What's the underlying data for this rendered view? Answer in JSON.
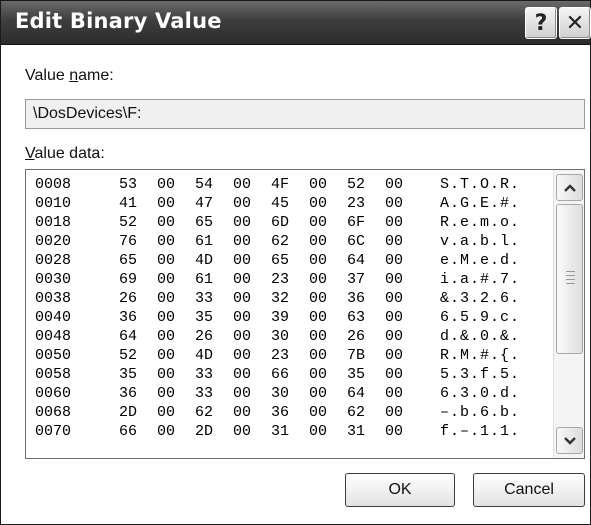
{
  "window": {
    "title": "Edit Binary Value"
  },
  "titlebar": {
    "help_glyph": "?",
    "close_glyph": "✕"
  },
  "value_name": {
    "label_prefix": "Value ",
    "label_accel": "n",
    "label_suffix": "ame:",
    "value": "\\DosDevices\\F:"
  },
  "value_data": {
    "label_accel": "V",
    "label_suffix": "alue data:",
    "rows": [
      {
        "offset": "0008",
        "bytes": [
          "53",
          "00",
          "54",
          "00",
          "4F",
          "00",
          "52",
          "00"
        ],
        "ascii": "S.T.O.R."
      },
      {
        "offset": "0010",
        "bytes": [
          "41",
          "00",
          "47",
          "00",
          "45",
          "00",
          "23",
          "00"
        ],
        "ascii": "A.G.E.#."
      },
      {
        "offset": "0018",
        "bytes": [
          "52",
          "00",
          "65",
          "00",
          "6D",
          "00",
          "6F",
          "00"
        ],
        "ascii": "R.e.m.o."
      },
      {
        "offset": "0020",
        "bytes": [
          "76",
          "00",
          "61",
          "00",
          "62",
          "00",
          "6C",
          "00"
        ],
        "ascii": "v.a.b.l."
      },
      {
        "offset": "0028",
        "bytes": [
          "65",
          "00",
          "4D",
          "00",
          "65",
          "00",
          "64",
          "00"
        ],
        "ascii": "e.M.e.d."
      },
      {
        "offset": "0030",
        "bytes": [
          "69",
          "00",
          "61",
          "00",
          "23",
          "00",
          "37",
          "00"
        ],
        "ascii": "i.a.#.7."
      },
      {
        "offset": "0038",
        "bytes": [
          "26",
          "00",
          "33",
          "00",
          "32",
          "00",
          "36",
          "00"
        ],
        "ascii": "&.3.2.6."
      },
      {
        "offset": "0040",
        "bytes": [
          "36",
          "00",
          "35",
          "00",
          "39",
          "00",
          "63",
          "00"
        ],
        "ascii": "6.5.9.c."
      },
      {
        "offset": "0048",
        "bytes": [
          "64",
          "00",
          "26",
          "00",
          "30",
          "00",
          "26",
          "00"
        ],
        "ascii": "d.&.0.&."
      },
      {
        "offset": "0050",
        "bytes": [
          "52",
          "00",
          "4D",
          "00",
          "23",
          "00",
          "7B",
          "00"
        ],
        "ascii": "R.M.#.{."
      },
      {
        "offset": "0058",
        "bytes": [
          "35",
          "00",
          "33",
          "00",
          "66",
          "00",
          "35",
          "00"
        ],
        "ascii": "5.3.f.5."
      },
      {
        "offset": "0060",
        "bytes": [
          "36",
          "00",
          "33",
          "00",
          "30",
          "00",
          "64",
          "00"
        ],
        "ascii": "6.3.0.d."
      },
      {
        "offset": "0068",
        "bytes": [
          "2D",
          "00",
          "62",
          "00",
          "36",
          "00",
          "62",
          "00"
        ],
        "ascii": "–.b.6.b."
      },
      {
        "offset": "0070",
        "bytes": [
          "66",
          "00",
          "2D",
          "00",
          "31",
          "00",
          "31",
          "00"
        ],
        "ascii": "f.–.1.1."
      }
    ]
  },
  "buttons": {
    "ok": "OK",
    "cancel": "Cancel"
  }
}
